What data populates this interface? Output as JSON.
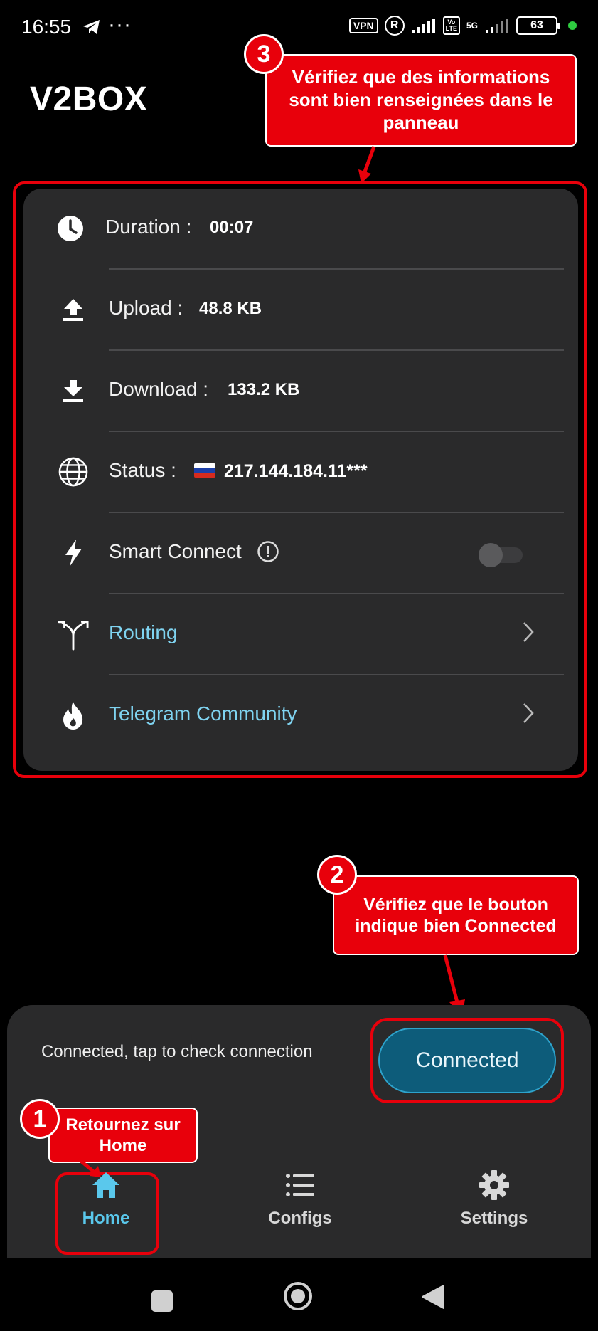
{
  "status_bar": {
    "time": "16:55",
    "overflow": "···",
    "vpn": "VPN",
    "registered": "R",
    "volte": "Vo\nLTE",
    "network": "5G",
    "battery": "63"
  },
  "app": {
    "title": "V2BOX"
  },
  "callouts": {
    "panel_check": {
      "number": "3",
      "text": "Vérifiez que des informations sont bien renseignées dans le panneau"
    },
    "button_check": {
      "number": "2",
      "text": "Vérifiez que le bouton indique bien Connected"
    },
    "home_return": {
      "number": "1",
      "text": "Retournez sur Home"
    }
  },
  "panel": {
    "duration": {
      "label": "Duration :",
      "value": "00:07",
      "icon": "clock-icon"
    },
    "upload": {
      "label": "Upload :",
      "value": "48.8 KB",
      "icon": "upload-icon"
    },
    "download": {
      "label": "Download :",
      "value": "133.2 KB",
      "icon": "download-icon"
    },
    "status": {
      "label": "Status :",
      "value": "217.144.184.11***",
      "icon": "globe-icon",
      "flag": "russia-flag-icon"
    },
    "smart_connect": {
      "label": "Smart Connect",
      "icon": "bolt-icon",
      "enabled": false
    },
    "routing": {
      "label": "Routing",
      "icon": "routing-fork-icon"
    },
    "telegram": {
      "label": "Telegram Community",
      "icon": "flame-icon"
    }
  },
  "connection": {
    "hint": "Connected, tap to check connection",
    "button_label": "Connected",
    "button_color": "#0d5c7a"
  },
  "bottom_nav": {
    "items": [
      {
        "label": "Home",
        "icon": "home-icon",
        "active": true
      },
      {
        "label": "Configs",
        "icon": "list-icon",
        "active": false
      },
      {
        "label": "Settings",
        "icon": "gear-icon",
        "active": false
      }
    ]
  },
  "colors": {
    "accent": "#5ac8ec",
    "link": "#7fd3f0",
    "callout_red": "#e8000b",
    "panel_bg": "#2a2a2b"
  }
}
